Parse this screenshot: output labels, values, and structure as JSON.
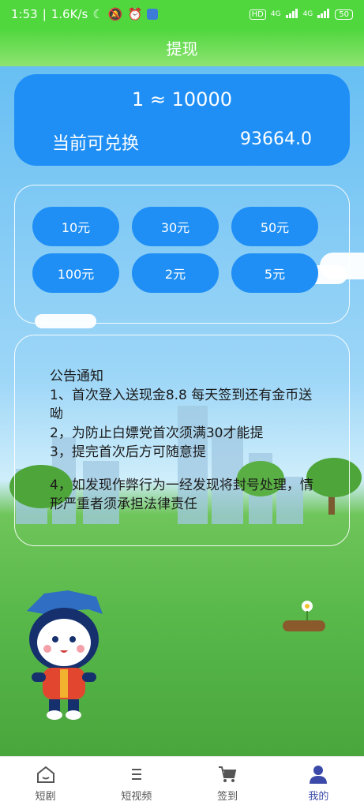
{
  "status_bar": {
    "time": "1:53",
    "speed": "1.6K/s",
    "battery": "50",
    "signal_labels": [
      "HD",
      "4G",
      "4G"
    ]
  },
  "title": "提现",
  "rate_card": {
    "rate": "1 ≈ 10000",
    "available_label": "当前可兑换",
    "available_value": "93664.0"
  },
  "amounts": [
    "10元",
    "30元",
    "50元",
    "100元",
    "2元",
    "5元"
  ],
  "notice": {
    "heading": "公告通知",
    "line1": "1、首次登入送现金8.8  每天签到还有金币送呦",
    "line2": "2，为防止白嫖党首次须满30才能提",
    "line3": "3，提完首次后方可随意提",
    "line4": "4，如发现作弊行为一经发现将封号处理，情形严重者须承担法律责任"
  },
  "tabs": [
    {
      "label": "短剧",
      "icon": "home-icon"
    },
    {
      "label": "短视频",
      "icon": "menu-icon"
    },
    {
      "label": "签到",
      "icon": "cart-icon"
    },
    {
      "label": "我的",
      "icon": "user-icon",
      "active": true
    }
  ],
  "colors": {
    "accent": "#1f8ff5",
    "header": "#4fd73d",
    "active_tab": "#3b4aa8"
  }
}
